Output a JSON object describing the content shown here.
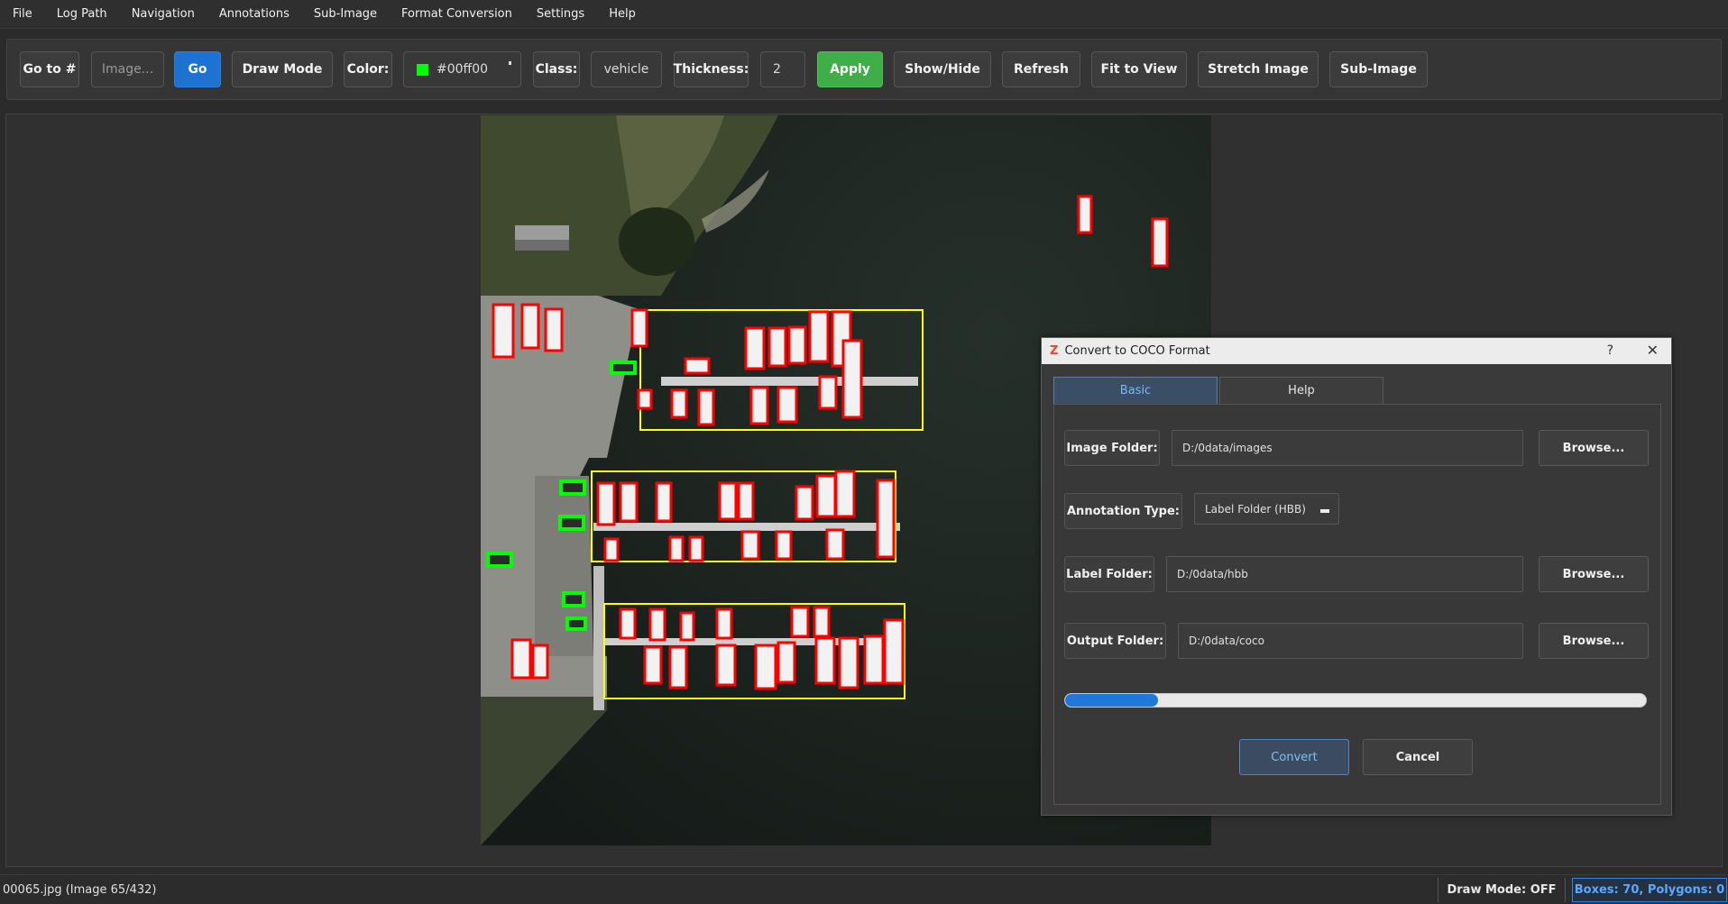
{
  "menu": [
    "File",
    "Log Path",
    "Navigation",
    "Annotations",
    "Sub-Image",
    "Format Conversion",
    "Settings",
    "Help"
  ],
  "toolbar": {
    "goto_label": "Go to #",
    "image_placeholder": "Image...",
    "go_label": "Go",
    "draw_mode_label": "Draw Mode",
    "color_label": "Color:",
    "color_value": "#00ff00",
    "class_label": "Class:",
    "class_value": "vehicle",
    "thickness_label": "Thickness:",
    "thickness_value": "2",
    "apply_label": "Apply",
    "show_hide_label": "Show/Hide",
    "refresh_label": "Refresh",
    "fit_label": "Fit to View",
    "stretch_label": "Stretch Image",
    "subimage_label": "Sub-Image"
  },
  "status": {
    "file": "00065.jpg (Image 65/432)",
    "draw_mode": "Draw Mode: OFF",
    "counts": "Boxes: 70, Polygons: 0"
  },
  "dialog": {
    "title": "Convert to COCO Format",
    "logo": "Z",
    "help_glyph": "?",
    "close_glyph": "✕",
    "tabs": [
      "Basic",
      "Help"
    ],
    "image_folder_label": "Image Folder:",
    "image_folder_value": "D:/0data/images",
    "annotation_type_label": "Annotation Type:",
    "annotation_type_value": "Label Folder (HBB)",
    "label_folder_label": "Label Folder:",
    "label_folder_value": "D:/0data/hbb",
    "output_folder_label": "Output Folder:",
    "output_folder_value": "D:/0data/coco",
    "browse_label": "Browse...",
    "progress_fraction": 0.16,
    "convert_label": "Convert",
    "cancel_label": "Cancel"
  },
  "colors": {
    "vehicle_box": "#00ff00",
    "boat_box": "#ff0000",
    "group_box": "#ffff00",
    "accent_blue": "#1e73d2",
    "apply_green": "#3fae49"
  }
}
